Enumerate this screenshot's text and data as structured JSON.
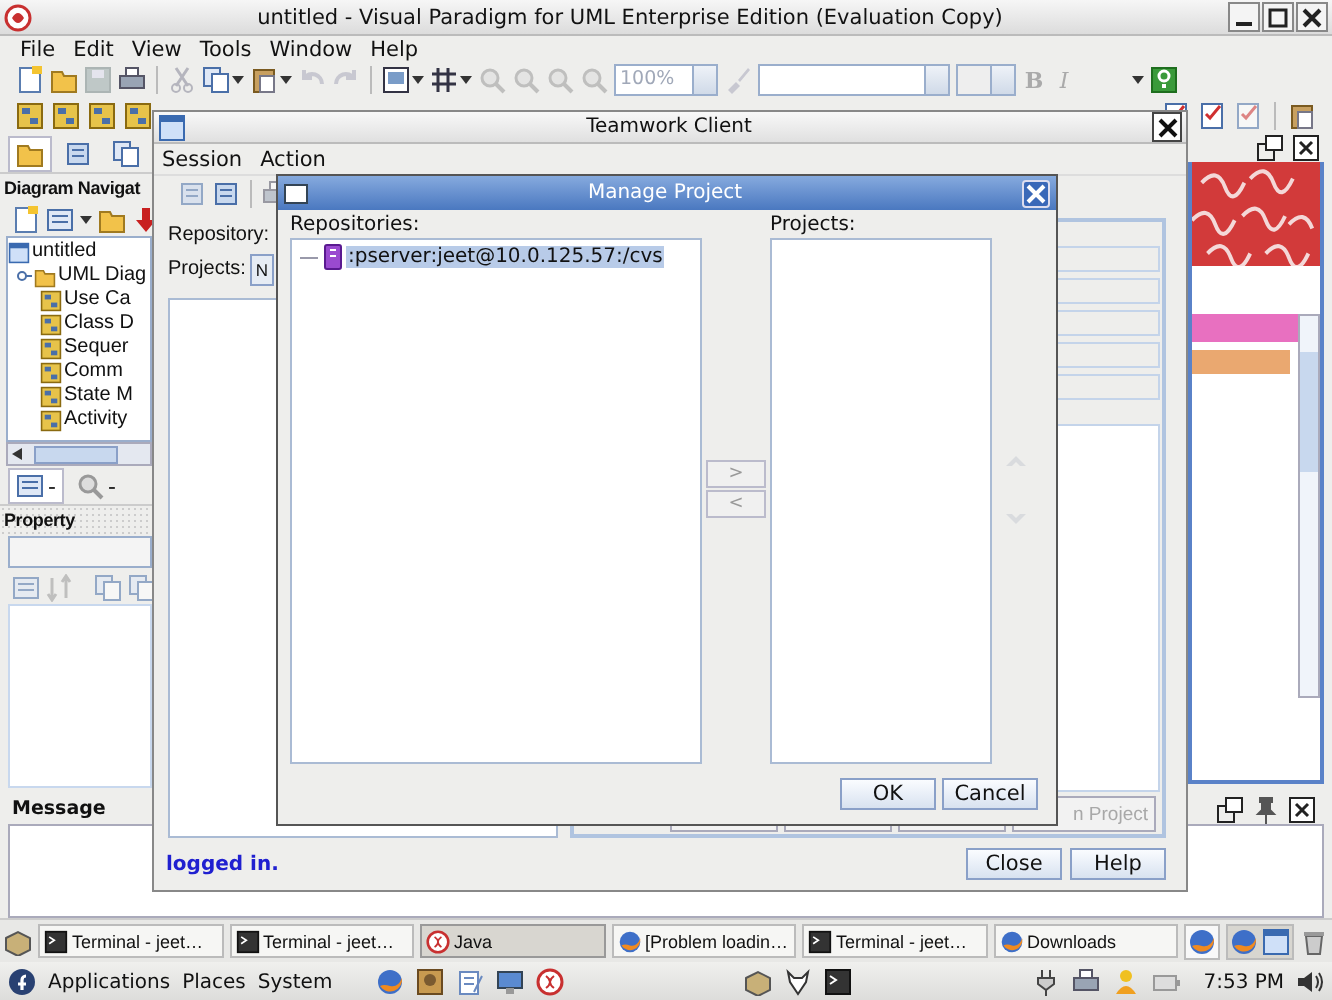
{
  "app": {
    "title": "untitled - Visual Paradigm for UML Enterprise Edition (Evaluation Copy)",
    "menu": [
      "File",
      "Edit",
      "View",
      "Tools",
      "Window",
      "Help"
    ],
    "zoom": "100%",
    "bold": "B",
    "italic": "I"
  },
  "navigator": {
    "title": "Diagram Navigat",
    "tree": [
      {
        "label": "untitled",
        "kind": "project",
        "children": [
          {
            "label": "UML Diag",
            "kind": "folder",
            "expanded": true,
            "children": [
              {
                "label": "Use Ca",
                "kind": "diagram"
              },
              {
                "label": "Class D",
                "kind": "diagram"
              },
              {
                "label": "Sequer",
                "kind": "diagram"
              },
              {
                "label": "Comm",
                "kind": "diagram"
              },
              {
                "label": "State M",
                "kind": "diagram"
              },
              {
                "label": "Activity",
                "kind": "diagram"
              }
            ]
          }
        ]
      }
    ],
    "tabs": [
      {
        "label": "-",
        "selected": true
      },
      {
        "label": "-",
        "selected": false
      }
    ]
  },
  "property": {
    "title": "Property"
  },
  "message": {
    "title": "Message"
  },
  "teamwork": {
    "title": "Teamwork Client",
    "menu": [
      "Session",
      "Action"
    ],
    "repository_label": "Repository:",
    "projects_label": "Projects:",
    "projects_button": "N",
    "actions": [
      {
        "disabled": false
      },
      {
        "disabled": false
      },
      {
        "disabled": false
      },
      {
        "label": "n Project",
        "disabled": true
      }
    ],
    "status": "logged in.",
    "buttons": [
      "Close",
      "Help"
    ]
  },
  "manage": {
    "title": "Manage Project",
    "repositories_label": "Repositories:",
    "repositories": [
      {
        "label": ":pserver:jeet@10.0.125.57:/cvs",
        "selected": true
      }
    ],
    "projects_label": "Projects:",
    "add": ">",
    "remove": "<",
    "buttons": [
      "OK",
      "Cancel"
    ]
  },
  "taskbar": [
    {
      "label": "Terminal - jeet…",
      "kind": "terminal",
      "selected": false
    },
    {
      "label": "Terminal - jeet…",
      "kind": "terminal",
      "selected": false
    },
    {
      "label": "Java",
      "kind": "java",
      "selected": true
    },
    {
      "label": "[Problem loadin…",
      "kind": "browser",
      "selected": false
    },
    {
      "label": "Terminal - jeet…",
      "kind": "terminal",
      "selected": false
    },
    {
      "label": "Downloads",
      "kind": "browser",
      "selected": false
    }
  ],
  "panel": {
    "menus": [
      "Applications",
      "Places",
      "System"
    ],
    "clock": "7:53 PM"
  }
}
